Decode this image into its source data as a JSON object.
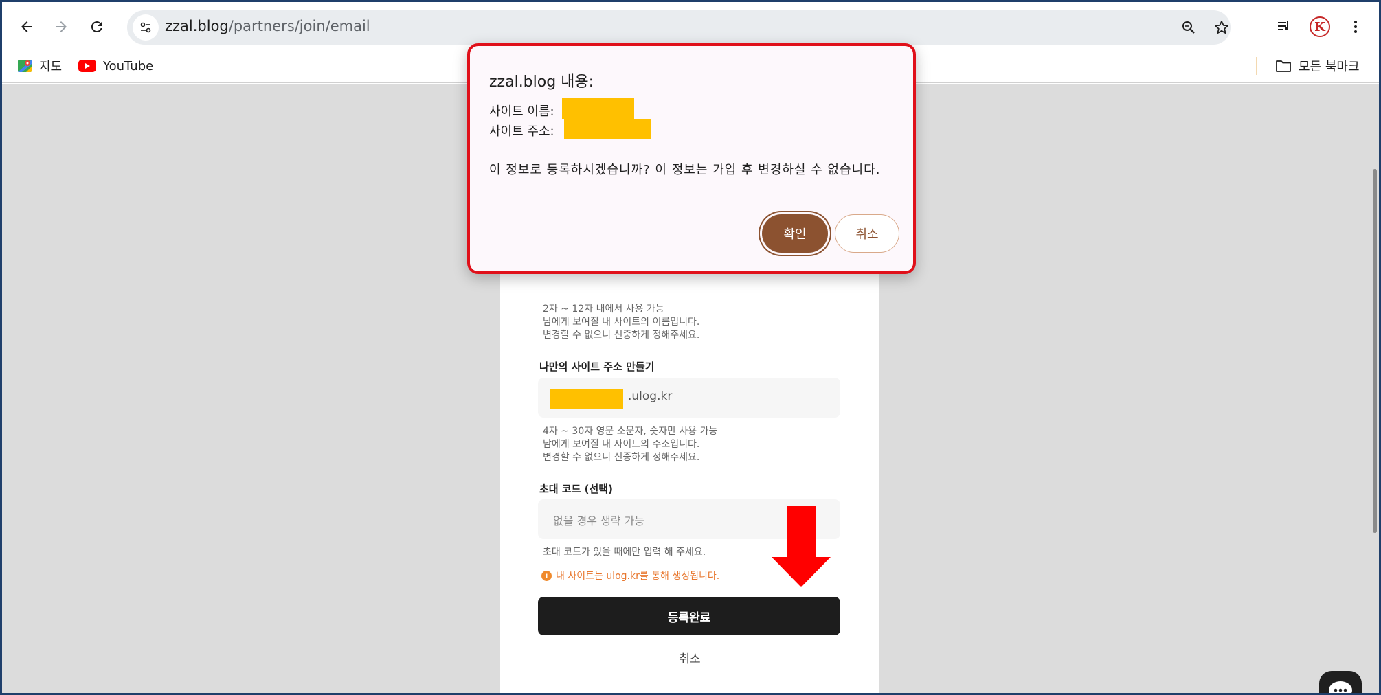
{
  "browser": {
    "url_host": "zzal.blog",
    "url_path": "/partners/join/email",
    "bookmarks": [
      {
        "label": "지도",
        "icon": "maps-icon"
      },
      {
        "label": "YouTube",
        "icon": "youtube-icon"
      }
    ],
    "all_bookmarks_label": "모든 북마크",
    "profile_letter": "K"
  },
  "form": {
    "site_name_help": [
      "2자 ~ 12자 내에서 사용 가능",
      "남에게 보여질 내 사이트의 이름입니다.",
      "변경할 수 없으니 신중하게 정해주세요."
    ],
    "site_address_label": "나만의 사이트 주소 만들기",
    "site_address_suffix": ".ulog.kr",
    "site_address_help": [
      "4자 ~ 30자 영문 소문자, 숫자만 사용 가능",
      "남에게 보여질 내 사이트의 주소입니다.",
      "변경할 수 없으니 신중하게 정해주세요."
    ],
    "invite_label": "초대 코드 (선택)",
    "invite_placeholder": "없을 경우 생략 가능",
    "invite_help": "초대 코드가 있을 때에만 입력 해 주세요.",
    "notice_prefix": "내 사이트는 ",
    "notice_link": "ulog.kr",
    "notice_suffix": "를 통해 생성됩니다.",
    "submit_label": "등록완료",
    "cancel_label": "취소"
  },
  "dialog": {
    "title": "zzal.blog 내용:",
    "site_name_label": "사이트 이름:",
    "site_address_label": "사이트 주소:",
    "message": "이 정보로 등록하시겠습니까? 이 정보는 가입 후 변경하실 수 없습니다.",
    "ok_label": "확인",
    "cancel_label": "취소"
  },
  "colors": {
    "redaction": "#ffc000",
    "dialog_border": "#e0101a",
    "ok_button": "#8c5230",
    "arrow": "#ff0000",
    "notice": "#e8772e"
  }
}
